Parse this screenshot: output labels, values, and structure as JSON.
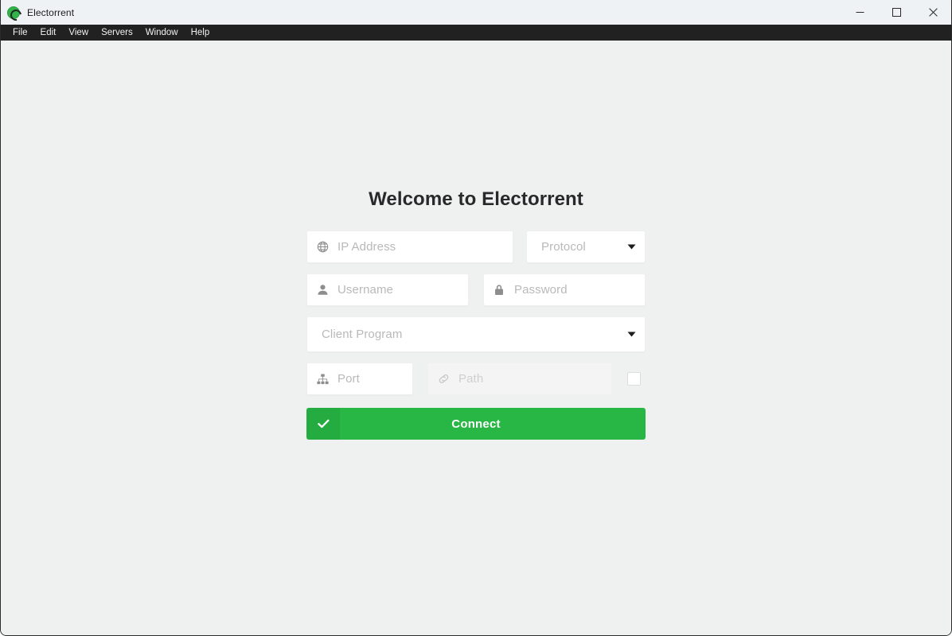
{
  "window": {
    "title": "Electorrent",
    "app_icon": "electorrent-logo-icon",
    "controls": {
      "minimize": "minimize-icon",
      "maximize": "maximize-icon",
      "close": "close-icon"
    }
  },
  "menubar": {
    "items": [
      {
        "label": "File"
      },
      {
        "label": "Edit"
      },
      {
        "label": "View"
      },
      {
        "label": "Servers"
      },
      {
        "label": "Window"
      },
      {
        "label": "Help"
      }
    ]
  },
  "main": {
    "heading": "Welcome to Electorrent",
    "fields": {
      "ip": {
        "placeholder": "IP Address",
        "value": "",
        "icon": "globe-icon"
      },
      "protocol": {
        "placeholder": "Protocol",
        "value": "",
        "icon": "chevron-down-icon"
      },
      "username": {
        "placeholder": "Username",
        "value": "",
        "icon": "user-icon"
      },
      "password": {
        "placeholder": "Password",
        "value": "",
        "icon": "lock-icon"
      },
      "client_program": {
        "placeholder": "Client Program",
        "value": "",
        "icon": "chevron-down-icon"
      },
      "port": {
        "placeholder": "Port",
        "value": "",
        "icon": "sitemap-icon"
      },
      "path": {
        "placeholder": "Path",
        "value": "",
        "icon": "link-icon",
        "disabled": true
      },
      "path_checkbox": {
        "checked": false
      }
    },
    "connect_button": {
      "label": "Connect",
      "icon": "check-icon"
    }
  },
  "colors": {
    "accent_green": "#28b745",
    "titlebar": "#eef2f5",
    "menubar": "#212121",
    "page_background": "#eff0f0",
    "placeholder_text": "#b9b9b9"
  }
}
